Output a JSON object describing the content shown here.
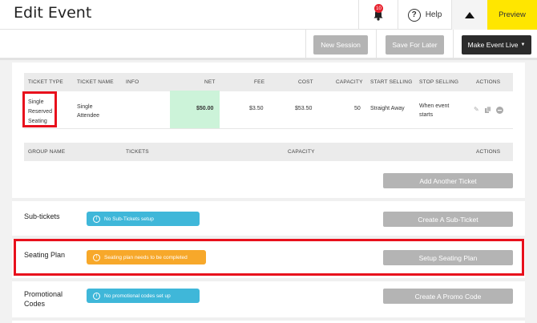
{
  "header": {
    "title": "Edit Event",
    "notification_count": "10",
    "help_label": "Help",
    "preview_label": "Preview"
  },
  "toolbar": {
    "new_session": "New Session",
    "save_for_later": "Save For Later",
    "make_live": "Make Event Live"
  },
  "tickets_table": {
    "headers": [
      "TICKET TYPE",
      "TICKET NAME",
      "INFO",
      "NET",
      "FEE",
      "COST",
      "CAPACITY",
      "START SELLING",
      "STOP SELLING",
      "ACTIONS"
    ],
    "row": {
      "type_line1": "Single",
      "type_line2": "Reserved",
      "type_line3": "Seating",
      "name_line1": "Single",
      "name_line2": "Attendee",
      "info": "",
      "net": "$50.00",
      "fee": "$3.50",
      "cost": "$53.50",
      "capacity": "50",
      "start_selling": "Straight Away",
      "stop_line1": "When event",
      "stop_line2": "starts"
    }
  },
  "groups_table": {
    "headers": [
      "GROUP NAME",
      "TICKETS",
      "CAPACITY",
      "ACTIONS"
    ]
  },
  "add_ticket_button": "Add Another Ticket",
  "sections": {
    "subtickets": {
      "label": "Sub-tickets",
      "pill": "No Sub-Tickets setup",
      "button": "Create A Sub-Ticket"
    },
    "seating": {
      "label": "Seating Plan",
      "pill": "Seating plan needs to be completed",
      "button": "Setup Seating Plan"
    },
    "promo": {
      "label_line1": "Promotional",
      "label_line2": "Codes",
      "pill": "No promotional codes set up",
      "button": "Create A Promo Code"
    }
  },
  "colors": {
    "preview_bg": "#ffe600",
    "highlight_red": "#e8101c",
    "info_blue": "#3fb7d9",
    "warning_orange": "#f7a82a",
    "net_green": "#ccf3d9"
  }
}
